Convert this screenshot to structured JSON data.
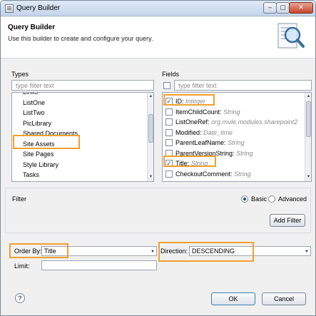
{
  "window": {
    "title": "Query Builder",
    "close_glyph": "✕",
    "min_glyph": "–",
    "max_glyph": "▢"
  },
  "banner": {
    "title": "Query Builder",
    "description": "Use this builder to create and configure your query.",
    "icon": "magnifier-document-icon"
  },
  "types": {
    "label": "Types",
    "filter_placeholder": "type filter text",
    "items": [
      "Links",
      "ListOne",
      "ListTwo",
      "PicLibrary",
      "Shared Documents",
      "Site Assets",
      "Site Pages",
      "Style Library",
      "Tasks"
    ],
    "selected": "Shared Documents"
  },
  "fields": {
    "label": "Fields",
    "filter_placeholder": "type filter text",
    "items": [
      {
        "name": "ID:",
        "type": "Integer",
        "checked": true
      },
      {
        "name": "ItemChildCount:",
        "type": "String",
        "checked": false
      },
      {
        "name": "ListOneRef:",
        "type": "org.mule.modules.sharepoint2",
        "checked": false
      },
      {
        "name": "Modified:",
        "type": "Date_time",
        "checked": false
      },
      {
        "name": "ParentLeafName:",
        "type": "String",
        "checked": false
      },
      {
        "name": "ParentVersionString:",
        "type": "String",
        "checked": false
      },
      {
        "name": "Title:",
        "type": "String",
        "checked": true
      },
      {
        "name": "CheckoutComment:",
        "type": "String",
        "checked": false
      }
    ]
  },
  "filter": {
    "label": "Filter",
    "basic_label": "Basic",
    "advanced_label": "Advanced",
    "add_filter_label": "Add Filter"
  },
  "order": {
    "order_by_label": "Order By:",
    "order_by_value": "Title",
    "direction_label": "Direction:",
    "direction_value": "DESCENDING",
    "limit_label": "Limit:",
    "limit_value": ""
  },
  "footer": {
    "help_glyph": "?",
    "ok_label": "OK",
    "cancel_label": "Cancel"
  },
  "colors": {
    "highlight": "#f0a02c",
    "check": "#1c4d8a"
  }
}
